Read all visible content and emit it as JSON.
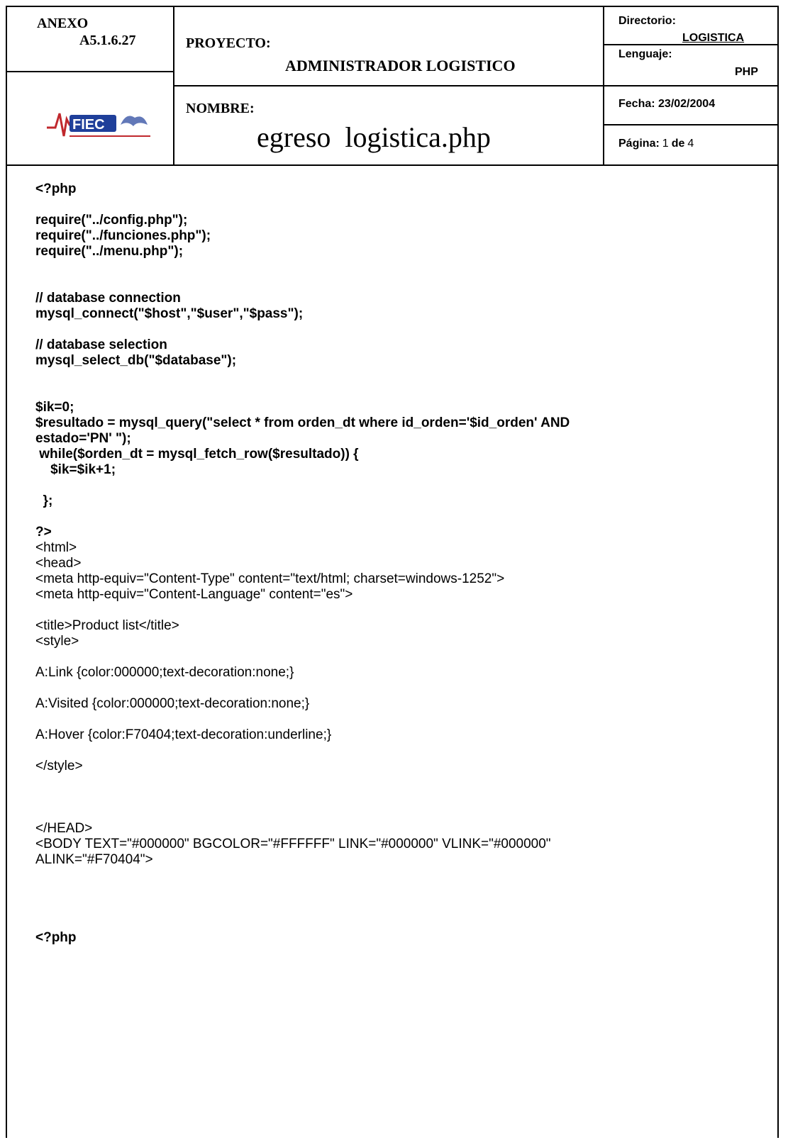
{
  "header": {
    "anexo_label": "ANEXO",
    "anexo_code": "A5.1.6.27",
    "proyecto_label": "PROYECTO:",
    "proyecto_value": "ADMINISTRADOR LOGISTICO",
    "nombre_label": "NOMBRE:",
    "nombre_value": "egreso  logistica.php",
    "directorio_label": "Directorio:",
    "directorio_value": "LOGISTICA",
    "lenguaje_label": "Lenguaje:",
    "lenguaje_value": "PHP",
    "fecha_label": "Fecha: 23/02/2004",
    "pagina_label": "Página:",
    "pagina_num": "1",
    "pagina_de": "de",
    "pagina_total": "4",
    "logo_text": "FIEC",
    "logo_icon": "fiec-logo-icon"
  },
  "code_lines": [
    {
      "text": "<?php",
      "bold": true
    },
    {
      "text": "",
      "bold": false
    },
    {
      "text": "require(\"../config.php\");",
      "bold": true
    },
    {
      "text": "require(\"../funciones.php\");",
      "bold": true
    },
    {
      "text": "require(\"../menu.php\");",
      "bold": true
    },
    {
      "text": "",
      "bold": false
    },
    {
      "text": "",
      "bold": false
    },
    {
      "text": "// database connection",
      "bold": true
    },
    {
      "text": "mysql_connect(\"$host\",\"$user\",\"$pass\");",
      "bold": true
    },
    {
      "text": "",
      "bold": false
    },
    {
      "text": "// database selection",
      "bold": true
    },
    {
      "text": "mysql_select_db(\"$database\");",
      "bold": true
    },
    {
      "text": "",
      "bold": false
    },
    {
      "text": "",
      "bold": false
    },
    {
      "text": "$ik=0;",
      "bold": true
    },
    {
      "text": "$resultado = mysql_query(\"select * from orden_dt where id_orden='$id_orden' AND",
      "bold": true
    },
    {
      "text": "estado='PN' \");",
      "bold": true
    },
    {
      "text": " while($orden_dt = mysql_fetch_row($resultado)) {",
      "bold": true
    },
    {
      "text": "    $ik=$ik+1;",
      "bold": true
    },
    {
      "text": "",
      "bold": false
    },
    {
      "text": "  };",
      "bold": true
    },
    {
      "text": "",
      "bold": false
    },
    {
      "text": "?>",
      "bold": true
    },
    {
      "text": "<html>",
      "bold": false
    },
    {
      "text": "<head>",
      "bold": false
    },
    {
      "text": "<meta http-equiv=\"Content-Type\" content=\"text/html; charset=windows-1252\">",
      "bold": false
    },
    {
      "text": "<meta http-equiv=\"Content-Language\" content=\"es\">",
      "bold": false
    },
    {
      "text": "",
      "bold": false
    },
    {
      "text": "<title>Product list</title>",
      "bold": false
    },
    {
      "text": "<style>",
      "bold": false
    },
    {
      "text": "",
      "bold": false
    },
    {
      "text": "A:Link {color:000000;text-decoration:none;}",
      "bold": false
    },
    {
      "text": "",
      "bold": false
    },
    {
      "text": "A:Visited {color:000000;text-decoration:none;}",
      "bold": false
    },
    {
      "text": "",
      "bold": false
    },
    {
      "text": "A:Hover {color:F70404;text-decoration:underline;}",
      "bold": false
    },
    {
      "text": "",
      "bold": false
    },
    {
      "text": "</style>",
      "bold": false
    },
    {
      "text": "",
      "bold": false
    },
    {
      "text": "",
      "bold": false
    },
    {
      "text": "",
      "bold": false
    },
    {
      "text": "</HEAD>",
      "bold": false
    },
    {
      "text": "<BODY TEXT=\"#000000\" BGCOLOR=\"#FFFFFF\" LINK=\"#000000\" VLINK=\"#000000\"",
      "bold": false
    },
    {
      "text": "ALINK=\"#F70404\">",
      "bold": false
    },
    {
      "text": "",
      "bold": false
    },
    {
      "text": "",
      "bold": false
    },
    {
      "text": "",
      "bold": false
    },
    {
      "text": "",
      "bold": false
    },
    {
      "text": "<?php",
      "bold": true
    }
  ],
  "colors": {
    "logo_blue": "#1f3f9a",
    "logo_red": "#c0282d",
    "border": "#000000"
  }
}
